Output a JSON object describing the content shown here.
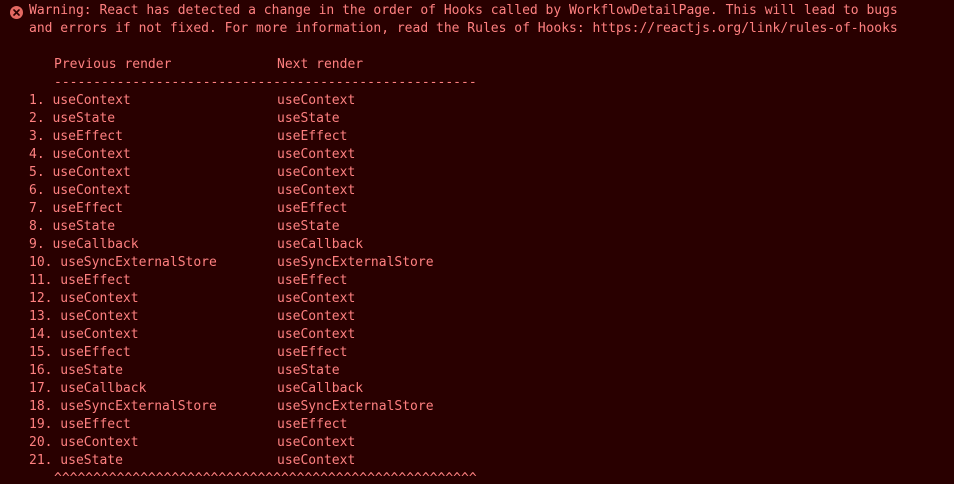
{
  "warning": {
    "line1": "Warning: React has detected a change in the order of Hooks called by WorkflowDetailPage. This will lead to bugs",
    "line2": "and errors if not fixed. For more information, read the Rules of Hooks: https://reactjs.org/link/rules-of-hooks"
  },
  "table": {
    "header_previous": "Previous render",
    "header_next": "Next render",
    "divider": "------------------------------------------------------",
    "rows": [
      {
        "prev": "1. useContext",
        "next": "useContext"
      },
      {
        "prev": "2. useState",
        "next": "useState"
      },
      {
        "prev": "3. useEffect",
        "next": "useEffect"
      },
      {
        "prev": "4. useContext",
        "next": "useContext"
      },
      {
        "prev": "5. useContext",
        "next": "useContext"
      },
      {
        "prev": "6. useContext",
        "next": "useContext"
      },
      {
        "prev": "7. useEffect",
        "next": "useEffect"
      },
      {
        "prev": "8. useState",
        "next": "useState"
      },
      {
        "prev": "9. useCallback",
        "next": "useCallback"
      },
      {
        "prev": "10. useSyncExternalStore",
        "next": "useSyncExternalStore"
      },
      {
        "prev": "11. useEffect",
        "next": "useEffect"
      },
      {
        "prev": "12. useContext",
        "next": "useContext"
      },
      {
        "prev": "13. useContext",
        "next": "useContext"
      },
      {
        "prev": "14. useContext",
        "next": "useContext"
      },
      {
        "prev": "15. useEffect",
        "next": "useEffect"
      },
      {
        "prev": "16. useState",
        "next": "useState"
      },
      {
        "prev": "17. useCallback",
        "next": "useCallback"
      },
      {
        "prev": "18. useSyncExternalStore",
        "next": "useSyncExternalStore"
      },
      {
        "prev": "19. useEffect",
        "next": "useEffect"
      },
      {
        "prev": "20. useContext",
        "next": "useContext"
      },
      {
        "prev": "21. useState",
        "next": "useContext"
      }
    ],
    "carets": "^^^^^^^^^^^^^^^^^^^^^^^^^^^^^^^^^^^^^^^^^^^^^^^^^^^^^^"
  },
  "colors": {
    "background": "#290000",
    "text": "#ff8080",
    "icon": "#e46962"
  },
  "icon": "error-circle-x-icon"
}
